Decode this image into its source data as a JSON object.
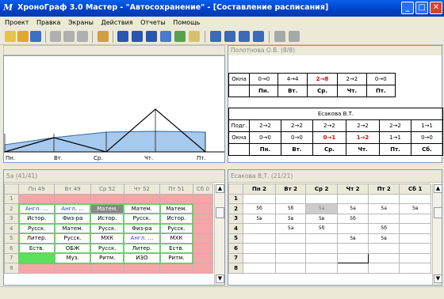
{
  "window": {
    "title": "ХроноГраф 3.0 Мастер - \"Автосохранение\" - [Составление расписания]",
    "icon_label": "M"
  },
  "menu": [
    "Проект",
    "Правка",
    "Экраны",
    "Действия",
    "Отчеты",
    "Помощь"
  ],
  "chart": {
    "days": [
      "Пн.",
      "Вт.",
      "Ср.",
      "Чт.",
      "Пт."
    ]
  },
  "panel_right_top": {
    "header": "Полотнова О.В. (8/8)",
    "table1": {
      "row_label": "Окна",
      "values": [
        "0→0",
        "4→4",
        "2→8",
        "2→2",
        "0→0"
      ],
      "red_index": 2,
      "days": [
        "Пн.",
        "Вт.",
        "Ср.",
        "Чт.",
        "Пт."
      ]
    },
    "table2": {
      "title": "Есакова В.Т.",
      "rows": [
        {
          "label": "Подг.",
          "values": [
            "2→2",
            "2→2",
            "2→2",
            "2→2",
            "2→2",
            "1→1"
          ]
        },
        {
          "label": "Окна",
          "values": [
            "0→0",
            "0→0",
            "0→1",
            "1→2",
            "1→1",
            "0→0"
          ]
        }
      ],
      "red_indices": [
        2,
        3
      ],
      "days": [
        "Пн.",
        "Вт.",
        "Ср.",
        "Чт.",
        "Пт.",
        "Сб."
      ]
    }
  },
  "class_panel": {
    "header": "5а (41/41)",
    "cols": [
      "Пн 49",
      "Вт 49",
      "Ср 52",
      "Чт 52",
      "Пт 51",
      "Сб 0"
    ],
    "row_numbers": [
      "1",
      "2",
      "3",
      "4",
      "5",
      "6",
      "7",
      "8"
    ],
    "rows": [
      [
        "",
        "",
        "",
        "",
        "",
        ""
      ],
      [
        "Англ. ...",
        "Англ. ...",
        "Матем.",
        "Матем.",
        "Матем.",
        ""
      ],
      [
        "Истор.",
        "Физ-ра",
        "Истор.",
        "Русск.",
        "Истор.",
        ""
      ],
      [
        "Русск.",
        "Матем.",
        "Русск.",
        "Физ-ра",
        "Русск.",
        ""
      ],
      [
        "Литер.",
        "Русск.",
        "МХК",
        "Англ. ...",
        "МХК",
        ""
      ],
      [
        "Еств.",
        "ОБЖ",
        "Русск.",
        "Литер.",
        "Еств.",
        ""
      ],
      [
        "",
        "Муз.",
        "Ритм.",
        "ИЗО",
        "Ритм.",
        ""
      ],
      [
        "",
        "",
        "",
        "",
        "",
        ""
      ]
    ]
  },
  "teacher_panel": {
    "header": "Есакова В.Т. (21/21)",
    "cols": [
      "Пн 2",
      "Вт 2",
      "Ср 2",
      "Чт 2",
      "Пт 2",
      "Сб 1"
    ],
    "row_numbers": [
      "1",
      "2",
      "3",
      "4",
      "5",
      "6",
      "7",
      "8"
    ],
    "rows": [
      [
        "",
        "",
        "",
        "",
        "",
        ""
      ],
      [
        "5б",
        "5б",
        "5а",
        "5а",
        "5а",
        "5в"
      ],
      [
        "5в",
        "5в",
        "5в",
        "5б",
        "",
        ""
      ],
      [
        "",
        "5а",
        "5б",
        "",
        "5б",
        ""
      ],
      [
        "",
        "",
        "",
        "5в",
        "5в",
        ""
      ],
      [
        "",
        "",
        "",
        "",
        "",
        ""
      ],
      [
        "",
        "",
        "",
        "",
        "",
        ""
      ],
      [
        "",
        "",
        "",
        "",
        "",
        ""
      ]
    ]
  }
}
